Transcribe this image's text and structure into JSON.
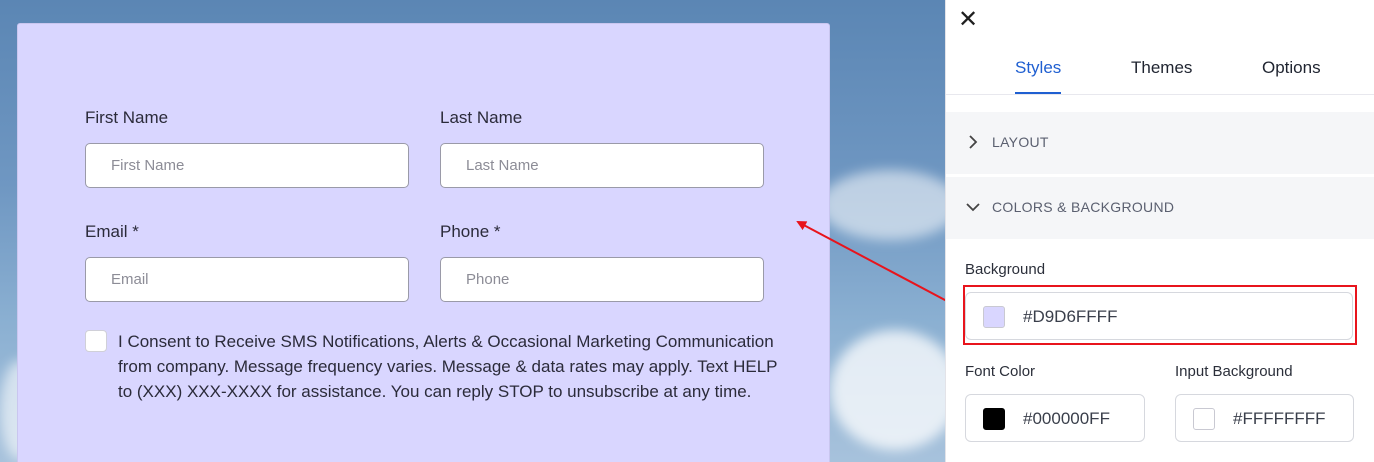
{
  "form": {
    "first_name_label": "First Name",
    "first_name_placeholder": "First Name",
    "last_name_label": "Last Name",
    "last_name_placeholder": "Last Name",
    "email_label": "Email *",
    "email_placeholder": "Email",
    "phone_label": "Phone *",
    "phone_placeholder": "Phone",
    "consent_text": "I Consent to Receive SMS Notifications, Alerts & Occasional Marketing Communication from company. Message frequency varies. Message & data rates may apply. Text HELP to (XXX) XXX-XXXX for assistance. You can reply STOP to unsubscribe at any time.",
    "background_color": "#D9D6FF"
  },
  "panel": {
    "close_icon": "close-icon",
    "tabs": [
      {
        "label": "Styles",
        "active": true
      },
      {
        "label": "Themes",
        "active": false
      },
      {
        "label": "Options",
        "active": false
      }
    ],
    "sections": [
      {
        "label": "LAYOUT",
        "expanded": false
      },
      {
        "label": "COLORS & BACKGROUND",
        "expanded": true
      }
    ],
    "background": {
      "label": "Background",
      "value": "#D9D6FFFF",
      "swatch": "#D9D6FF"
    },
    "font_color": {
      "label": "Font Color",
      "value": "#000000FF",
      "swatch": "#000000"
    },
    "input_background": {
      "label": "Input Background",
      "value": "#FFFFFFFF",
      "swatch": "#FFFFFF"
    }
  },
  "colors": {
    "accent": "#1F5FD1",
    "annotation": "#E8141C"
  }
}
